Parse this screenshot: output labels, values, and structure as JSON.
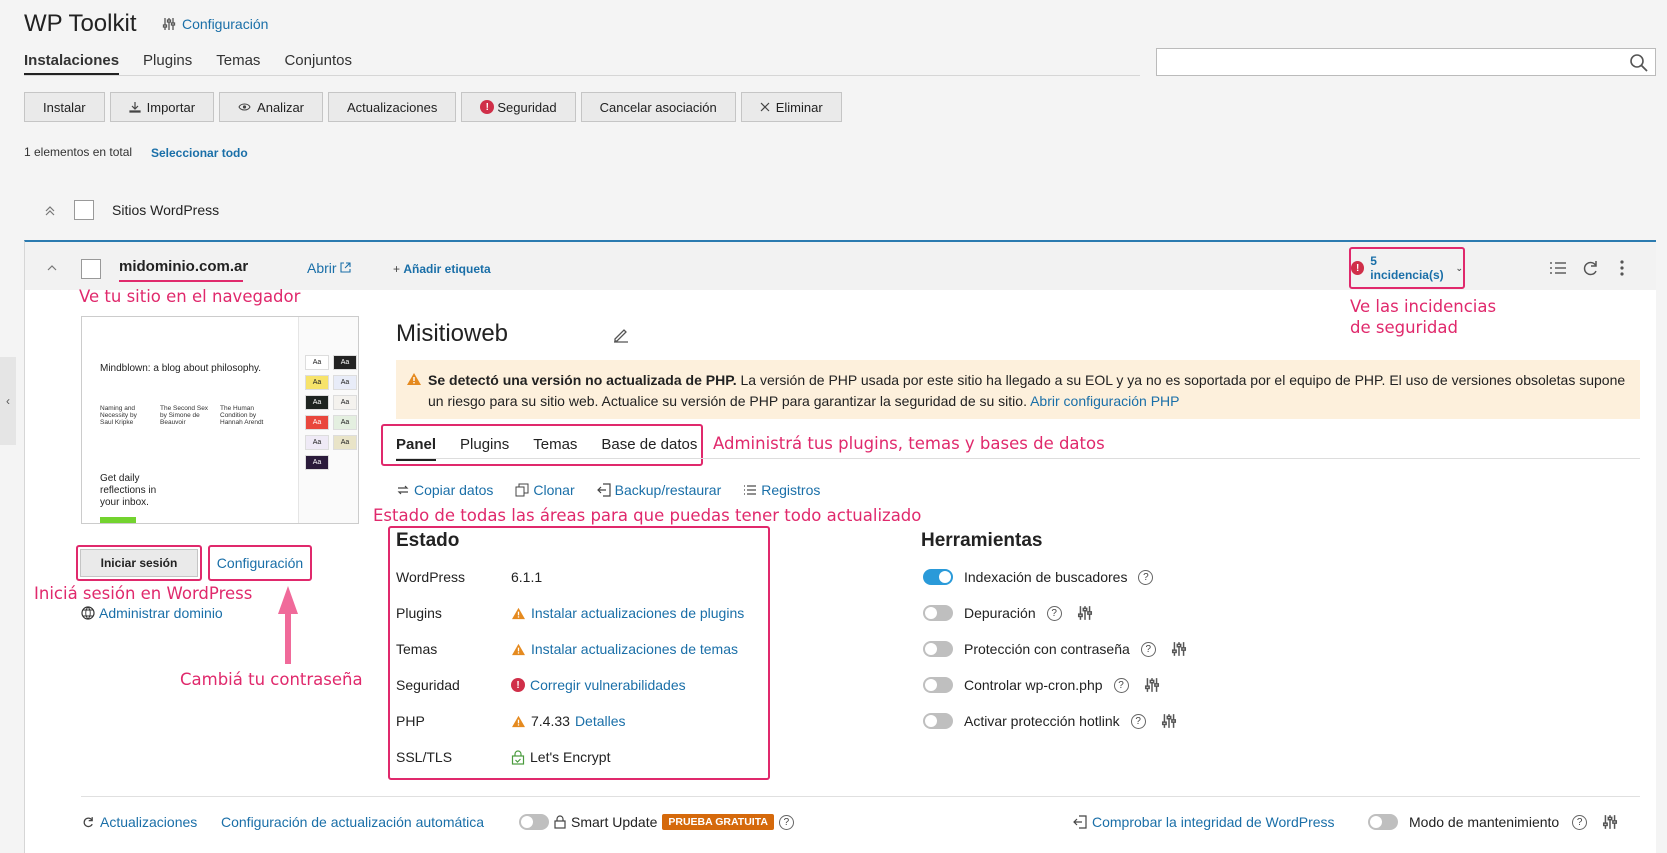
{
  "app": {
    "title": "WP Toolkit",
    "config_link": "Configuración"
  },
  "main_tabs": [
    "Instalaciones",
    "Plugins",
    "Temas",
    "Conjuntos"
  ],
  "search": {
    "placeholder": ""
  },
  "toolbar": [
    "Instalar",
    "Importar",
    "Analizar",
    "Actualizaciones",
    "Seguridad",
    "Cancelar asociación",
    "Eliminar"
  ],
  "selection": {
    "total": "1 elementos en total",
    "select_all": "Seleccionar todo"
  },
  "group": {
    "label": "Sitios WordPress"
  },
  "site": {
    "domain": "midominio.com.ar",
    "open": "Abrir",
    "add_tag": "Añadir etiqueta",
    "issues": "5 incidencia(s)",
    "name": "Misitioweb",
    "warning_bold": "Se detectó una versión no actualizada de PHP.",
    "warning_text": " La versión de PHP usada por este sitio ha llegado a su EOL y ya no es soportada por el equipo de PHP. El uso de versiones obsoletas supone un riesgo para su sitio web. Actualice su versión de PHP para garantizar la seguridad de su sitio.",
    "warning_link": "Abrir configuración PHP",
    "login": "Iniciar sesión",
    "settings": "Configuración",
    "manage_domain": "Administrar dominio"
  },
  "preview": {
    "blog_title": "Mindblown: a blog about philosophy.",
    "cols": [
      "Naming and Necessity by Saul Kripke",
      "The Second Sex by Simone de Beauvoir",
      "The Human Condition by Hannah Arendt"
    ],
    "get_daily": "Get daily reflections in your inbox.",
    "swatch_text": "Aa"
  },
  "inner_tabs": [
    "Panel",
    "Plugins",
    "Temas",
    "Base de datos"
  ],
  "actions": [
    "Copiar datos",
    "Clonar",
    "Backup/restaurar",
    "Registros"
  ],
  "estado": {
    "title": "Estado",
    "rows": [
      {
        "label": "WordPress",
        "value": "6.1.1"
      },
      {
        "label": "Plugins",
        "value": "Instalar actualizaciones de plugins"
      },
      {
        "label": "Temas",
        "value": "Instalar actualizaciones de temas"
      },
      {
        "label": "Seguridad",
        "value": "Corregir vulnerabilidades"
      },
      {
        "label": "PHP",
        "value": "7.4.33",
        "link": "Detalles"
      },
      {
        "label": "SSL/TLS",
        "value": "Let's Encrypt"
      }
    ]
  },
  "tools": {
    "title": "Herramientas",
    "items": [
      {
        "label": "Indexación de buscadores",
        "on": true
      },
      {
        "label": "Depuración",
        "on": false
      },
      {
        "label": "Protección con contraseña",
        "on": false
      },
      {
        "label": "Controlar wp-cron.php",
        "on": false
      },
      {
        "label": "Activar protección hotlink",
        "on": false
      }
    ]
  },
  "footer": {
    "updates": "Actualizaciones",
    "auto_config": "Configuración de actualización automática",
    "smart_update": "Smart Update",
    "trial": "PRUEBA GRATUITA",
    "integrity": "Comprobar la integridad de WordPress",
    "maintenance": "Modo de mantenimiento"
  },
  "annotations": {
    "browser": "Ve tu sitio en el navegador",
    "security": "Ve las incidencias",
    "security2": "de seguridad",
    "manage": "Administrá tus plugins, temas y bases de datos",
    "status": "Estado de todas las áreas para que puedas tener todo actualizado",
    "login": "Iniciá sesión en WordPress",
    "password": "Cambiá tu contraseña"
  },
  "colors": {
    "accent": "#1a6fa8",
    "annotation": "#e0296c",
    "danger": "#d02f49",
    "warning": "#e58a1f",
    "trial": "#d5690b"
  }
}
